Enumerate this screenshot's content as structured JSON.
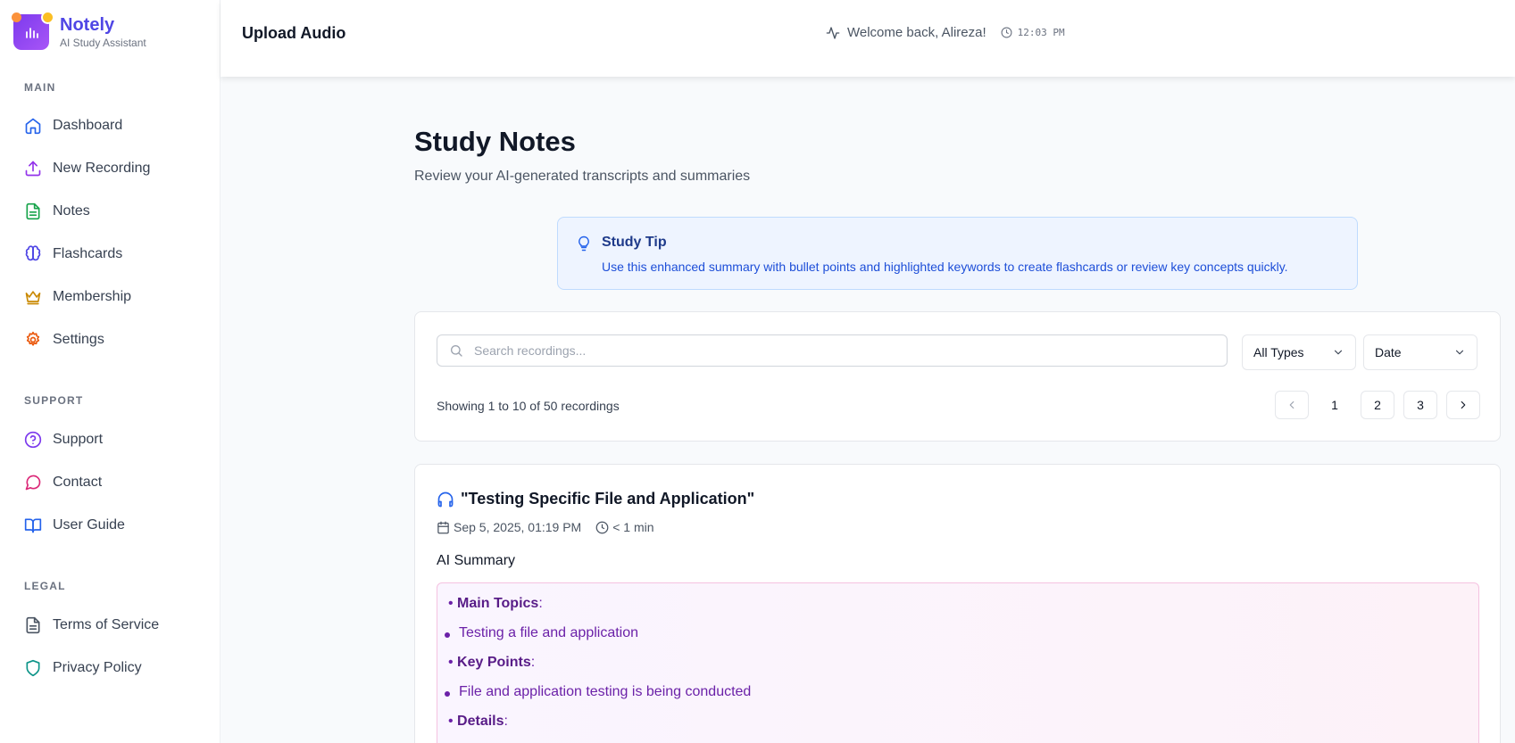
{
  "brand": {
    "name": "Notely",
    "subtitle": "AI Study Assistant"
  },
  "sidebar": {
    "sections": [
      {
        "label": "MAIN",
        "items": [
          {
            "label": "Dashboard",
            "icon": "home-icon",
            "color": "#2563eb"
          },
          {
            "label": "New Recording",
            "icon": "upload-icon",
            "color": "#9333ea"
          },
          {
            "label": "Notes",
            "icon": "document-icon",
            "color": "#16a34a"
          },
          {
            "label": "Flashcards",
            "icon": "brain-icon",
            "color": "#4f46e5"
          },
          {
            "label": "Membership",
            "icon": "crown-icon",
            "color": "#ca8a04"
          },
          {
            "label": "Settings",
            "icon": "gear-icon",
            "color": "#ea580c"
          }
        ]
      },
      {
        "label": "SUPPORT",
        "items": [
          {
            "label": "Support",
            "icon": "help-circle-icon",
            "color": "#7c3aed"
          },
          {
            "label": "Contact",
            "icon": "chat-bubble-icon",
            "color": "#db2777"
          },
          {
            "label": "User Guide",
            "icon": "book-icon",
            "color": "#2563eb"
          }
        ]
      },
      {
        "label": "LEGAL",
        "items": [
          {
            "label": "Terms of Service",
            "icon": "file-text-icon",
            "color": "#4b5563"
          },
          {
            "label": "Privacy Policy",
            "icon": "shield-icon",
            "color": "#0d9488"
          }
        ]
      }
    ]
  },
  "header": {
    "title": "Upload Audio",
    "welcome": "Welcome back, Alireza!",
    "time": "12:03 PM"
  },
  "page": {
    "title": "Study Notes",
    "subtitle": "Review your AI-generated transcripts and summaries"
  },
  "tip": {
    "title": "Study Tip",
    "text": "Use this enhanced summary with bullet points and highlighted keywords to create flashcards or review key concepts quickly."
  },
  "search": {
    "placeholder": "Search recordings...",
    "value": "",
    "type_filter": "All Types",
    "sort_filter": "Date",
    "showing": "Showing 1 to 10 of 50 recordings",
    "pages": [
      "1",
      "2",
      "3"
    ],
    "current_page": "1"
  },
  "recording": {
    "title": "\"Testing Specific File and Application\"",
    "date": "Sep 5, 2025, 01:19 PM",
    "duration": "< 1 min",
    "summary_label": "AI Summary",
    "summary": {
      "main_topics_label": "Main Topics",
      "main_topics_item": "Testing a file and application",
      "key_points_label": "Key Points",
      "key_points_item": "File and application testing is being conducted",
      "details_label": "Details"
    }
  }
}
